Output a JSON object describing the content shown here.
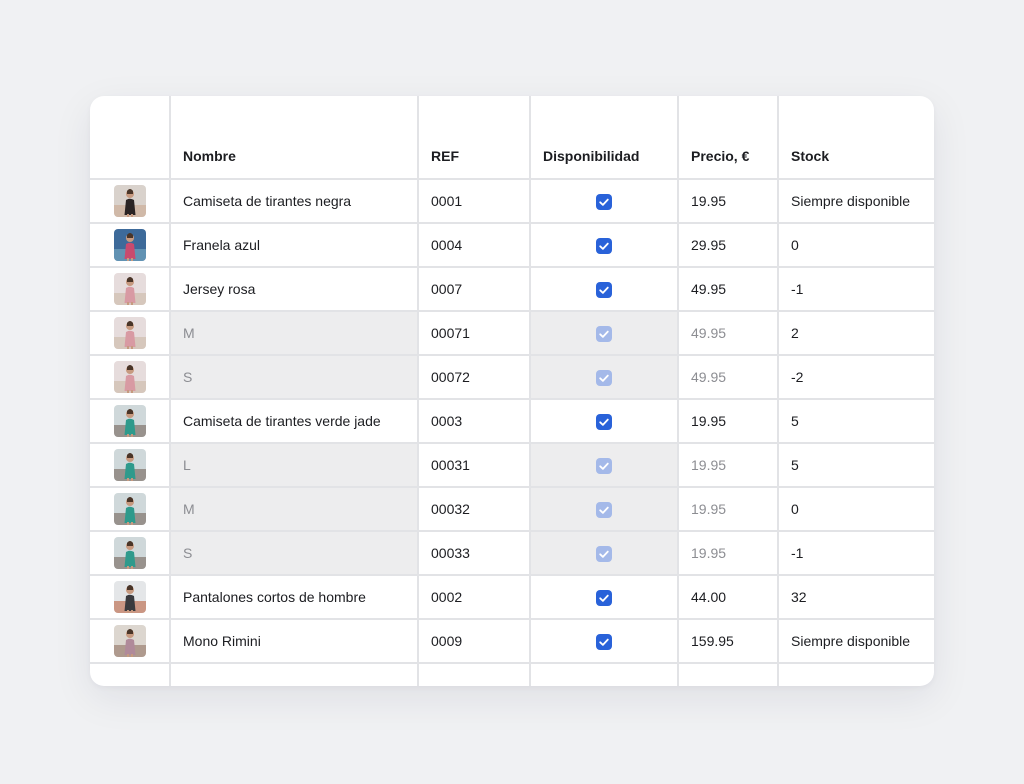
{
  "columns": {
    "image": "",
    "name": "Nombre",
    "ref": "REF",
    "availability": "Disponibilidad",
    "price": "Precio, €",
    "stock": "Stock"
  },
  "rows": [
    {
      "thumb": "black-tank-top",
      "name": "Camiseta de tirantes negra",
      "ref": "0001",
      "available": true,
      "variant": false,
      "price": "19.95",
      "stock": "Siempre disponible",
      "thumb_colors": [
        "#d9d2cc",
        "#2a2424",
        "#c9a48a"
      ]
    },
    {
      "thumb": "blue-flannel",
      "name": "Franela azul",
      "ref": "0004",
      "available": true,
      "variant": false,
      "price": "29.95",
      "stock": "0",
      "thumb_colors": [
        "#3d6a9a",
        "#c94a6e",
        "#7fb3c9"
      ]
    },
    {
      "thumb": "pink-sweater",
      "name": "Jersey rosa",
      "ref": "0007",
      "available": true,
      "variant": false,
      "price": "49.95",
      "stock": "-1",
      "thumb_colors": [
        "#e6dcdc",
        "#d89aa3",
        "#c9b6a2"
      ]
    },
    {
      "thumb": "pink-sweater",
      "name": "M",
      "ref": "00071",
      "available": true,
      "variant": true,
      "price": "49.95",
      "stock": "2",
      "thumb_colors": [
        "#e6dcdc",
        "#d89aa3",
        "#c9b6a2"
      ]
    },
    {
      "thumb": "pink-sweater",
      "name": "S",
      "ref": "00072",
      "available": true,
      "variant": true,
      "price": "49.95",
      "stock": "-2",
      "thumb_colors": [
        "#e6dcdc",
        "#d89aa3",
        "#c9b6a2"
      ]
    },
    {
      "thumb": "jade-tank-top",
      "name": "Camiseta de tirantes verde jade",
      "ref": "0003",
      "available": true,
      "variant": false,
      "price": "19.95",
      "stock": "5",
      "thumb_colors": [
        "#cfd8da",
        "#2f9a8c",
        "#6b5a4e"
      ]
    },
    {
      "thumb": "jade-tank-top",
      "name": "L",
      "ref": "00031",
      "available": true,
      "variant": true,
      "price": "19.95",
      "stock": "5",
      "thumb_colors": [
        "#cfd8da",
        "#2f9a8c",
        "#6b5a4e"
      ]
    },
    {
      "thumb": "jade-tank-top",
      "name": "M",
      "ref": "00032",
      "available": true,
      "variant": true,
      "price": "19.95",
      "stock": "0",
      "thumb_colors": [
        "#cfd8da",
        "#2f9a8c",
        "#6b5a4e"
      ]
    },
    {
      "thumb": "jade-tank-top",
      "name": "S",
      "ref": "00033",
      "available": true,
      "variant": true,
      "price": "19.95",
      "stock": "-1",
      "thumb_colors": [
        "#cfd8da",
        "#2f9a8c",
        "#6b5a4e"
      ]
    },
    {
      "thumb": "mens-shorts",
      "name": "Pantalones cortos de hombre",
      "ref": "0002",
      "available": true,
      "variant": false,
      "price": "44.00",
      "stock": "32",
      "thumb_colors": [
        "#e4e6e8",
        "#3a3a3e",
        "#b5542f"
      ]
    },
    {
      "thumb": "rimini-jumpsuit",
      "name": "Mono Rimini",
      "ref": "0009",
      "available": true,
      "variant": false,
      "price": "159.95",
      "stock": "Siempre disponible",
      "thumb_colors": [
        "#dcd6cf",
        "#b08a9a",
        "#8a6a5a"
      ]
    }
  ],
  "colors": {
    "checkbox": "#2962d9",
    "checkbox_variant": "#a4b9e9",
    "variant_cell_bg": "#ededee",
    "muted_text": "#8c8d92"
  }
}
